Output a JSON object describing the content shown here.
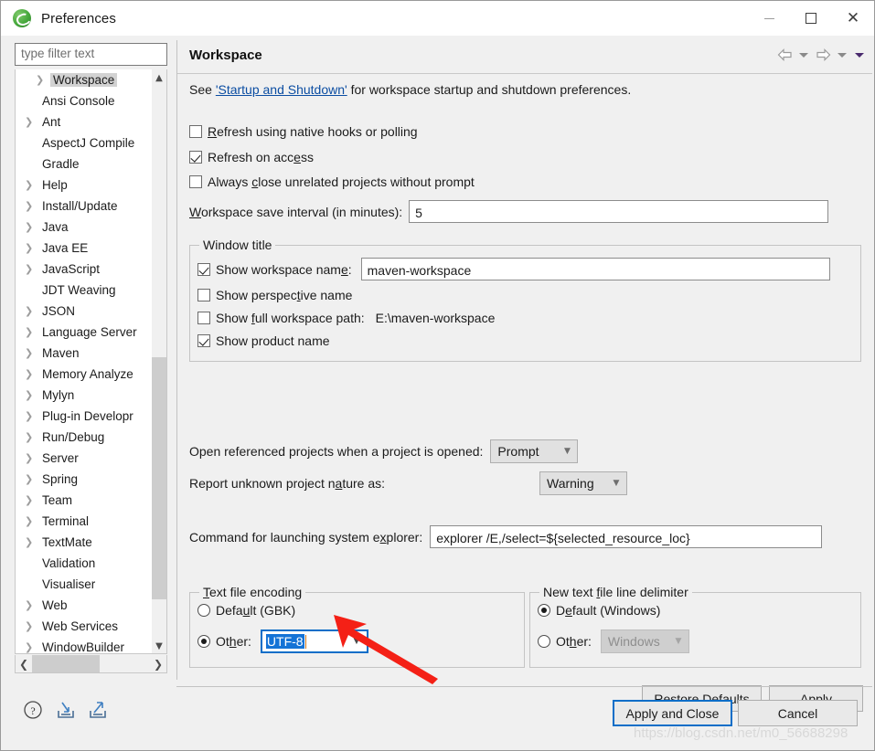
{
  "window": {
    "title": "Preferences",
    "icon": "eclipse-icon",
    "minimize": "minimize-icon",
    "maximize": "maximize-icon",
    "close": "close-icon"
  },
  "sidebar": {
    "filter_placeholder": "type filter text",
    "items": [
      {
        "label": "Workspace",
        "expandable": true,
        "selected": true,
        "indent": true
      },
      {
        "label": "Ansi Console",
        "expandable": false,
        "selected": false,
        "indent": false
      },
      {
        "label": "Ant",
        "expandable": true,
        "selected": false,
        "indent": false
      },
      {
        "label": "AspectJ Compile",
        "expandable": false,
        "selected": false,
        "indent": false
      },
      {
        "label": "Gradle",
        "expandable": false,
        "selected": false,
        "indent": false
      },
      {
        "label": "Help",
        "expandable": true,
        "selected": false,
        "indent": false
      },
      {
        "label": "Install/Update",
        "expandable": true,
        "selected": false,
        "indent": false
      },
      {
        "label": "Java",
        "expandable": true,
        "selected": false,
        "indent": false
      },
      {
        "label": "Java EE",
        "expandable": true,
        "selected": false,
        "indent": false
      },
      {
        "label": "JavaScript",
        "expandable": true,
        "selected": false,
        "indent": false
      },
      {
        "label": "JDT Weaving",
        "expandable": false,
        "selected": false,
        "indent": false
      },
      {
        "label": "JSON",
        "expandable": true,
        "selected": false,
        "indent": false
      },
      {
        "label": "Language Server",
        "expandable": true,
        "selected": false,
        "indent": false
      },
      {
        "label": "Maven",
        "expandable": true,
        "selected": false,
        "indent": false
      },
      {
        "label": "Memory Analyze",
        "expandable": true,
        "selected": false,
        "indent": false
      },
      {
        "label": "Mylyn",
        "expandable": true,
        "selected": false,
        "indent": false
      },
      {
        "label": "Plug-in Developr",
        "expandable": true,
        "selected": false,
        "indent": false
      },
      {
        "label": "Run/Debug",
        "expandable": true,
        "selected": false,
        "indent": false
      },
      {
        "label": "Server",
        "expandable": true,
        "selected": false,
        "indent": false
      },
      {
        "label": "Spring",
        "expandable": true,
        "selected": false,
        "indent": false
      },
      {
        "label": "Team",
        "expandable": true,
        "selected": false,
        "indent": false
      },
      {
        "label": "Terminal",
        "expandable": true,
        "selected": false,
        "indent": false
      },
      {
        "label": "TextMate",
        "expandable": true,
        "selected": false,
        "indent": false
      },
      {
        "label": "Validation",
        "expandable": false,
        "selected": false,
        "indent": false
      },
      {
        "label": "Visualiser",
        "expandable": false,
        "selected": false,
        "indent": false
      },
      {
        "label": "Web",
        "expandable": true,
        "selected": false,
        "indent": false
      },
      {
        "label": "Web Services",
        "expandable": true,
        "selected": false,
        "indent": false
      },
      {
        "label": "WindowBuilder",
        "expandable": true,
        "selected": false,
        "indent": false
      }
    ],
    "scroll_up": "chevron-up-icon",
    "scroll_down": "chevron-down-icon",
    "scroll_left": "chevron-left-icon",
    "scroll_right": "chevron-right-icon"
  },
  "page": {
    "title": "Workspace",
    "nav": {
      "back": "back-arrow-icon",
      "back_menu": "chevron-down-icon",
      "forward": "forward-arrow-icon",
      "forward_menu": "chevron-down-icon",
      "view_menu": "view-menu-icon"
    },
    "lead_prefix": "See ",
    "lead_link": "'Startup and Shutdown'",
    "lead_suffix": " for workspace startup and shutdown preferences.",
    "checkboxes": [
      {
        "label": "Refresh using native hooks or polling",
        "checked": false
      },
      {
        "label": "Refresh on access",
        "checked": true
      },
      {
        "label": "Always close unrelated projects without prompt",
        "checked": false
      }
    ],
    "save_interval": {
      "label": "Workspace save interval (in minutes):",
      "value": "5"
    },
    "window_title_group": {
      "title": "Window title",
      "show_workspace_name": {
        "label": "Show workspace name:",
        "checked": true,
        "value": "maven-workspace"
      },
      "show_perspective_name": {
        "label": "Show perspective name",
        "checked": false
      },
      "show_full_path": {
        "label": "Show full workspace path:",
        "checked": false,
        "value": "E:\\maven-workspace"
      },
      "show_product_name": {
        "label": "Show product name",
        "checked": true
      }
    },
    "open_referenced": {
      "label": "Open referenced projects when a project is opened:",
      "value": "Prompt"
    },
    "report_nature": {
      "label": "Report unknown project nature as:",
      "value": "Warning"
    },
    "explorer_command": {
      "label": "Command for launching system explorer:",
      "value": "explorer /E,/select=${selected_resource_loc}"
    },
    "text_file_encoding": {
      "title": "Text file encoding",
      "default_label": "Default (GBK)",
      "default_selected": false,
      "other_label": "Other:",
      "other_selected": true,
      "other_value": "UTF-8"
    },
    "line_delimiter": {
      "title": "New text file line delimiter",
      "default_label": "Default (Windows)",
      "default_selected": true,
      "other_label": "Other:",
      "other_selected": false,
      "other_value": "Windows"
    },
    "restore_defaults": "Restore Defaults",
    "apply": "Apply"
  },
  "footer": {
    "help_icon": "help-icon",
    "import_icon": "import-icon",
    "export_icon": "export-icon",
    "apply_and_close": "Apply and Close",
    "cancel": "Cancel"
  },
  "annotation": {
    "arrow": "red-arrow-annotation",
    "arrow_color": "#f42016",
    "watermark": "https://blog.csdn.net/m0_56688298"
  }
}
